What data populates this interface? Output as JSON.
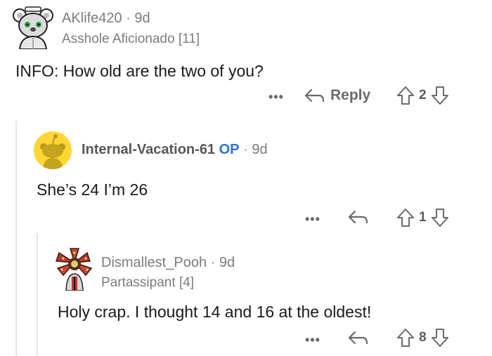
{
  "comments": [
    {
      "username": "AKlife420",
      "separator": "·",
      "age": "9d",
      "flair": "Asshole Aficionado [11]",
      "text": "INFO: How old are the two of you?",
      "more_label": "•••",
      "reply_label": "Reply",
      "score": "2",
      "avatar_icon": "koala-avatar-icon"
    },
    {
      "username": "Internal-Vacation-61",
      "op_badge": "OP",
      "separator": "·",
      "age": "9d",
      "text": "She’s 24 I’m 26",
      "more_label": "•••",
      "score": "1",
      "avatar_icon": "snoo-avatar-icon",
      "avatar_color": "#ffd635"
    },
    {
      "username": "Dismallest_Pooh",
      "separator": "·",
      "age": "9d",
      "flair": "Partassipant [4]",
      "text": "Holy crap.  I thought 14 and 16 at the oldest!",
      "more_label": "•••",
      "score": "8",
      "avatar_icon": "demogorgon-avatar-icon"
    }
  ],
  "colors": {
    "thread_line": "#e6e6e6",
    "op": "#2f73d6",
    "meta_text": "#7c7c7c"
  }
}
